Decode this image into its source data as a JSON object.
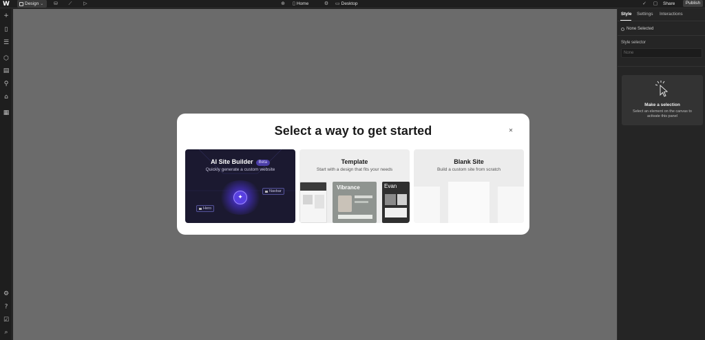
{
  "topbar": {
    "mode_label": "Design",
    "page_label": "Home",
    "breakpoint_label": "Desktop",
    "share_label": "Share",
    "publish_label": "Publish",
    "icons": [
      "webflow-logo-icon",
      "database-icon",
      "chart-icon",
      "play-icon",
      "globe-icon",
      "page-icon",
      "settings-icon",
      "desktop-icon",
      "check-icon",
      "comment-icon"
    ]
  },
  "left_rail": {
    "icons": [
      "add-icon",
      "pages-icon",
      "navigator-icon",
      "components-icon",
      "assets-icon",
      "variables-icon",
      "cms-icon",
      "apps-icon",
      "settings-icon",
      "help-icon",
      "audit-icon",
      "search-icon"
    ]
  },
  "right_panel": {
    "tabs": [
      {
        "label": "Style",
        "active": true
      },
      {
        "label": "Settings",
        "active": false
      },
      {
        "label": "Interactions",
        "active": false
      }
    ],
    "selection_label": "None Selected",
    "style_selector_label": "Style selector",
    "style_selector_placeholder": "None",
    "make_selection_title": "Make a selection",
    "make_selection_desc": "Select an element on the canvas to activate this panel"
  },
  "modal": {
    "title": "Select a way to get started",
    "close_icon": "close-icon",
    "cards": {
      "ai": {
        "title": "AI Site Builder",
        "badge": "Beta",
        "desc": "Quickly generate a custom website",
        "chip_navbar": "Navbar",
        "chip_hero": "Hero"
      },
      "template": {
        "title": "Template",
        "desc": "Start with a design that fits your needs",
        "thumb_vibrance": "Vibrance",
        "thumb_evan": "Evan"
      },
      "blank": {
        "title": "Blank Site",
        "desc": "Build a custom site from scratch"
      }
    }
  },
  "colors": {
    "canvas": "#6b6b6b",
    "chrome": "#1e1e1e",
    "panel": "#252525",
    "ai_card": "#1b1930",
    "accent": "#5840e0"
  }
}
